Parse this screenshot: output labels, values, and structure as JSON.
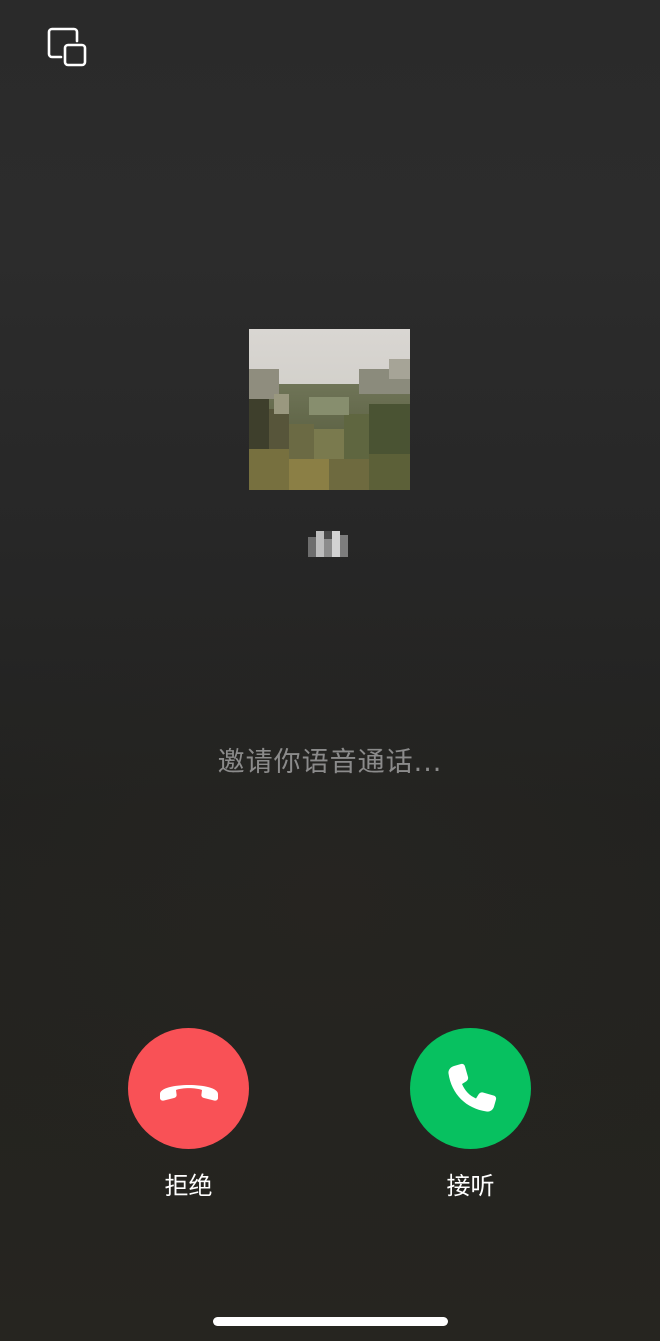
{
  "call": {
    "status": "邀请你语音通话...",
    "caller_avatar": "landscape-photo-pixelated"
  },
  "toolbar": {
    "minimize_icon": "picture-in-picture-icon"
  },
  "actions": {
    "decline_label": "拒绝",
    "accept_label": "接听",
    "decline_color": "#F95156",
    "accept_color": "#07C160",
    "decline_icon": "phone-hangup-icon",
    "accept_icon": "phone-icon"
  },
  "colors": {
    "background": "#262626",
    "status_text": "#8B8B8B",
    "label_text": "#FFFFFF"
  }
}
